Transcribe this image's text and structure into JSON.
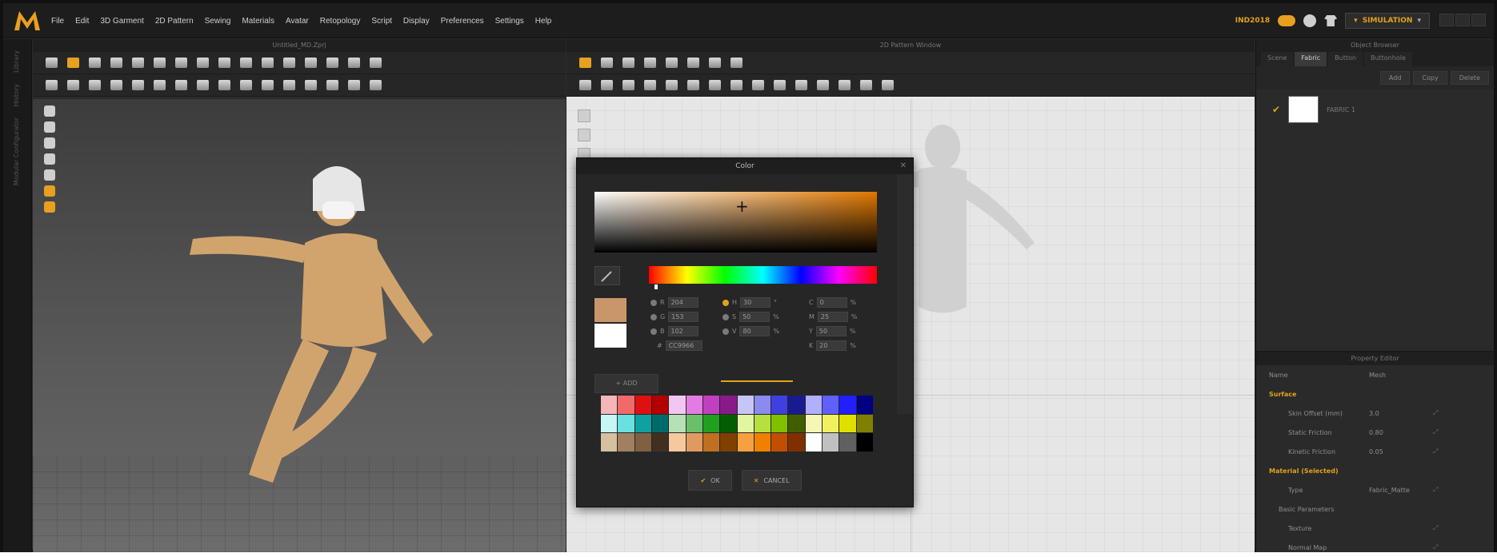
{
  "menu": [
    "File",
    "Edit",
    "3D Garment",
    "2D Pattern",
    "Sewing",
    "Materials",
    "Avatar",
    "Retopology",
    "Script",
    "Display",
    "Preferences",
    "Settings",
    "Help"
  ],
  "header": {
    "edition": "IND2018",
    "mode": "SIMULATION"
  },
  "panels": {
    "view3d_title": "Untitled_MD.Zprj",
    "view2d_title": "2D Pattern Window",
    "browser_title": "Object Browser",
    "props_title": "Property Editor"
  },
  "sidebar_labels": [
    "Library",
    "History",
    "Modular Configurator"
  ],
  "browser": {
    "tabs": [
      "Scene",
      "Fabric",
      "Button",
      "Buttonhole"
    ],
    "add": "Add",
    "copy": "Copy",
    "delete": "Delete",
    "fabric_name": "FABRIC 1"
  },
  "props": {
    "head": {
      "name": "Name",
      "value": "Mesh"
    },
    "rows": [
      {
        "n": "Surface",
        "sec": true
      },
      {
        "n": "Skin Offset (mm)",
        "v": "3.0"
      },
      {
        "n": "Static Friction",
        "v": "0.80"
      },
      {
        "n": "Kinetic Friction",
        "v": "0.05"
      },
      {
        "n": "Material (Selected)",
        "sec": true
      },
      {
        "n": "Type",
        "v": "Fabric_Matte"
      },
      {
        "n": "Basic Parameters",
        "sub": true
      },
      {
        "n": "Texture",
        "v": ""
      },
      {
        "n": "Normal Map",
        "v": ""
      }
    ]
  },
  "dialog": {
    "title": "Color",
    "fields": {
      "R": "204",
      "G": "153",
      "B": "102",
      "H": "30",
      "S": "50",
      "V": "80",
      "C": "0",
      "M": "25",
      "Y": "50",
      "K": "20",
      "hex": "CC9966"
    },
    "add": "ADD",
    "ok": "OK",
    "cancel": "CANCEL",
    "palette": [
      "#f4b6b6",
      "#f06a6a",
      "#e01010",
      "#b30000",
      "#f2c6f2",
      "#e27ce2",
      "#c040c0",
      "#8a1a8a",
      "#c6c6f6",
      "#8a8af0",
      "#4040e0",
      "#1a1a90",
      "#b0b0ff",
      "#6060ff",
      "#2020ff",
      "#000080",
      "#c6f6f6",
      "#6ae0e0",
      "#10a0a0",
      "#006a6a",
      "#b6e0b6",
      "#6ac06a",
      "#20a020",
      "#006000",
      "#e0f6a0",
      "#b6e040",
      "#80c000",
      "#406000",
      "#f6f6b6",
      "#f0f060",
      "#e0e000",
      "#808000",
      "#d6c0a0",
      "#a08060",
      "#806040",
      "#403020",
      "#f6c8a0",
      "#e09a60",
      "#c07020",
      "#804000",
      "#f6a040",
      "#f08000",
      "#c05000",
      "#803000",
      "#ffffff",
      "#c0c0c0",
      "#606060",
      "#000000"
    ]
  }
}
